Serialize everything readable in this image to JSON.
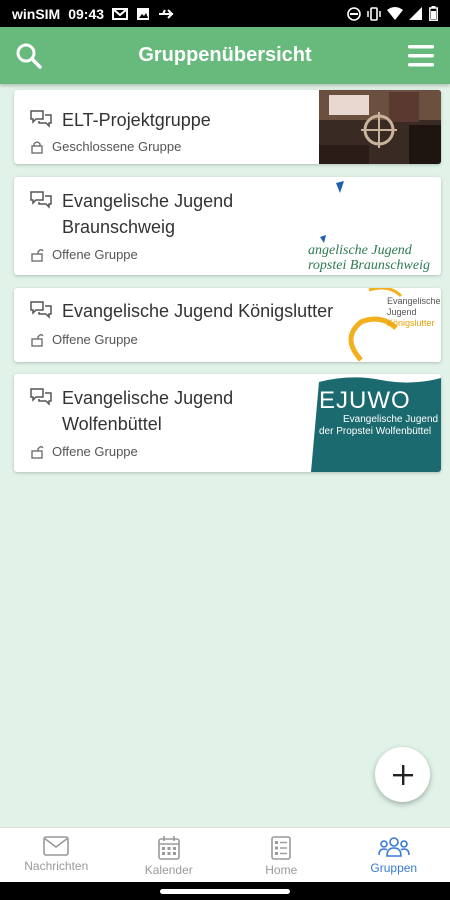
{
  "status_bar": {
    "carrier": "winSIM",
    "time": "09:43"
  },
  "app_bar": {
    "title": "Gruppenübersicht"
  },
  "groups": [
    {
      "name": "ELT-Projektgruppe",
      "type": "Geschlossene Gruppe",
      "locked": true
    },
    {
      "name": "Evangelische Jugend Braunschweig",
      "type": "Offene Gruppe",
      "locked": false,
      "logo_text": [
        "angelische Jugend",
        "ropstei Braunschweig"
      ]
    },
    {
      "name": "Evangelische Jugend Königslutter",
      "type": "Offene Gruppe",
      "locked": false,
      "logo_text": [
        "Evangelische",
        "Jugend",
        "Königslutter"
      ]
    },
    {
      "name": "Evangelische Jugend Wolfenbüttel",
      "type": "Offene Gruppe",
      "locked": false,
      "logo_text": [
        "EJUWO",
        "Evangelische Jugend",
        "der Propstei Wolfenbüttel"
      ]
    }
  ],
  "bottom_nav": [
    {
      "label": "Nachrichten",
      "icon": "mail-icon",
      "active": false
    },
    {
      "label": "Kalender",
      "icon": "calendar-icon",
      "active": false
    },
    {
      "label": "Home",
      "icon": "home-list-icon",
      "active": false
    },
    {
      "label": "Gruppen",
      "icon": "groups-icon",
      "active": true
    }
  ],
  "colors": {
    "header": "#67b97c",
    "background": "#e1f3e8",
    "active_nav": "#3a7bd5"
  }
}
